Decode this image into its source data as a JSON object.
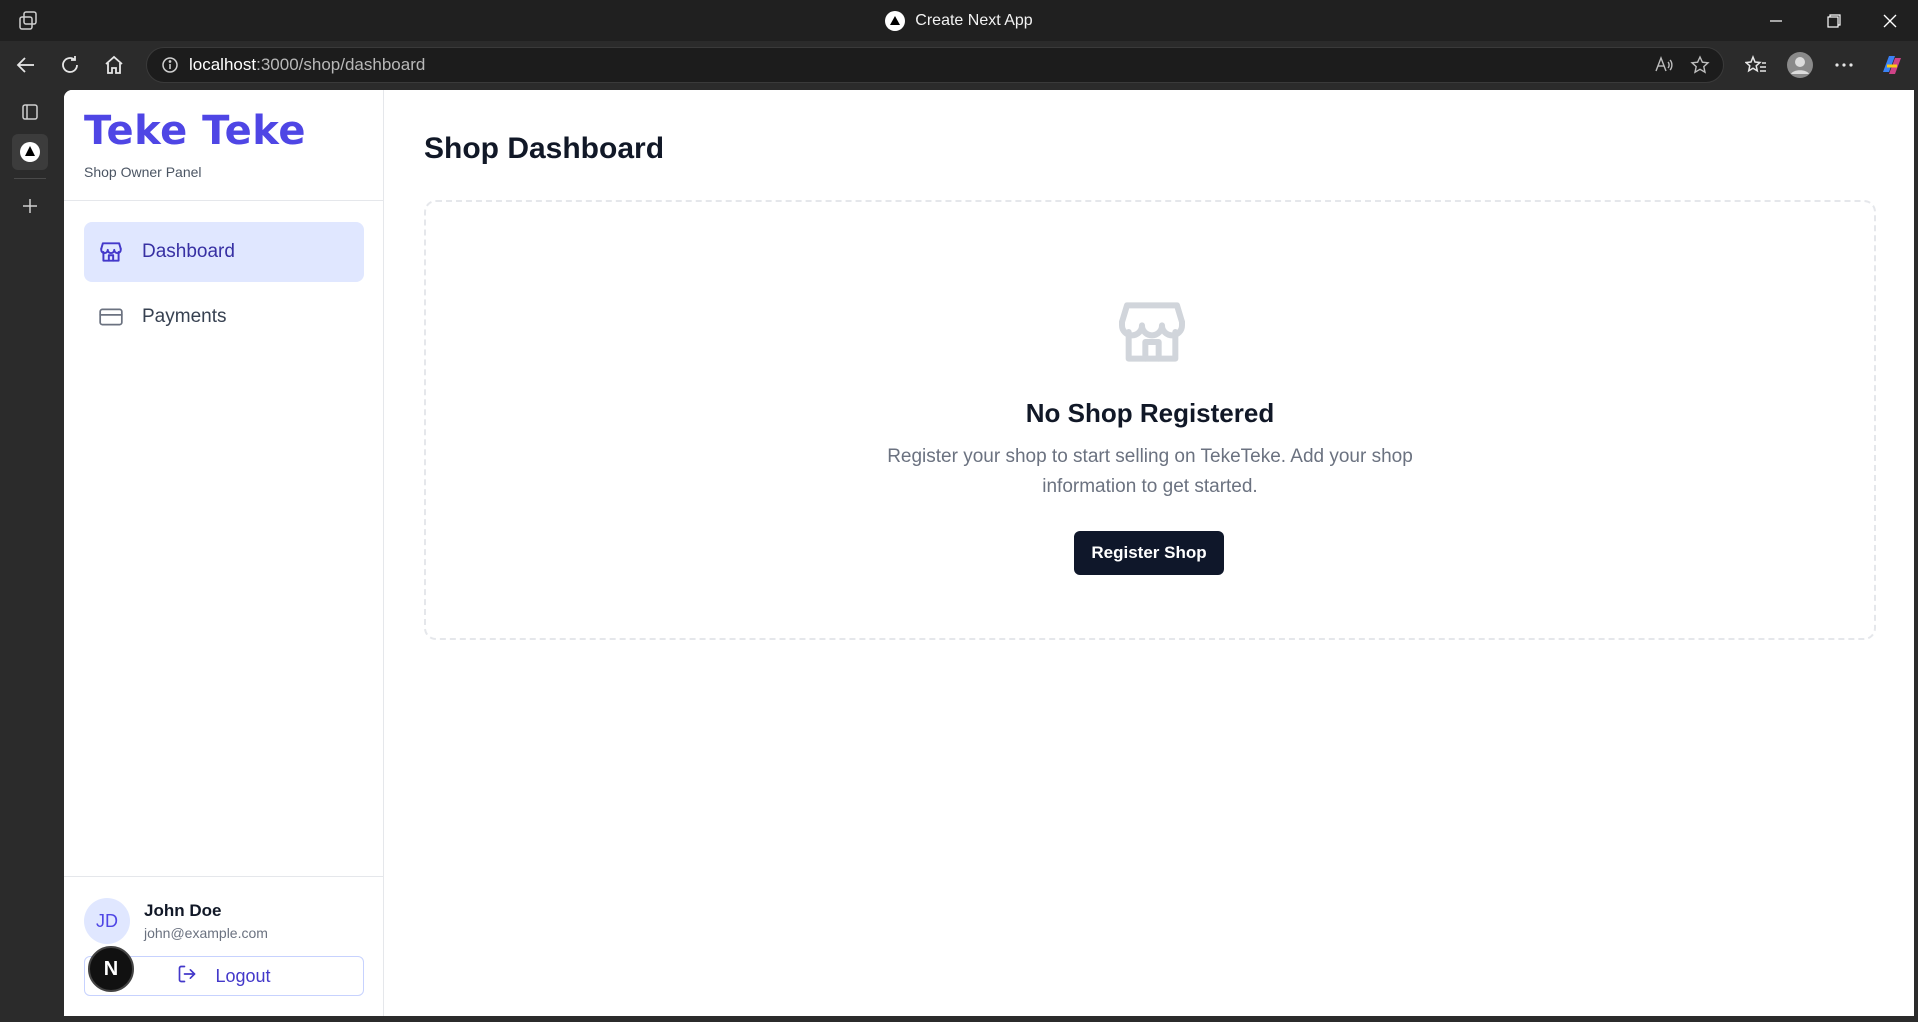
{
  "window": {
    "title": "Create Next App"
  },
  "browser": {
    "url_host": "localhost",
    "url_path": ":3000/shop/dashboard"
  },
  "sidebar": {
    "brand": "Teke Teke",
    "subtitle": "Shop Owner Panel",
    "items": [
      {
        "label": "Dashboard",
        "icon": "store-icon",
        "active": true
      },
      {
        "label": "Payments",
        "icon": "credit-card-icon",
        "active": false
      }
    ],
    "user": {
      "initials": "JD",
      "name": "John Doe",
      "email": "john@example.com"
    },
    "logout_label": "Logout"
  },
  "nextjs_badge": "N",
  "main": {
    "title": "Shop Dashboard",
    "empty_state": {
      "title": "No Shop Registered",
      "description": "Register your shop to start selling on TekeTeke. Add your shop information to get started.",
      "button_label": "Register Shop"
    }
  },
  "colors": {
    "brand": "#4f46e5",
    "nav_active_bg": "#e0e7ff",
    "primary_button": "#0f172a"
  }
}
